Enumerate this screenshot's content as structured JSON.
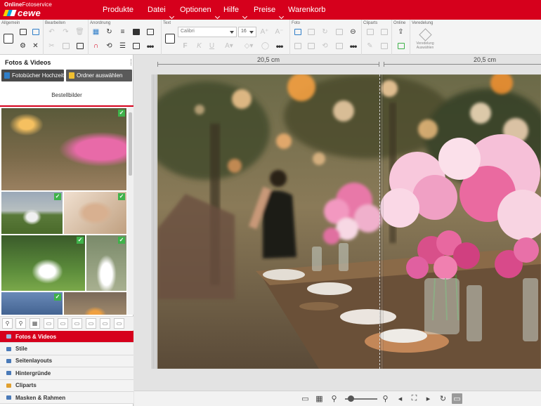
{
  "app": {
    "logo_top_bold": "Online",
    "logo_top_rest": "Fotoservice",
    "logo_brand": "cewe"
  },
  "menu": [
    {
      "label": "Produkte",
      "has_dropdown": false
    },
    {
      "label": "Datei",
      "has_dropdown": true
    },
    {
      "label": "Optionen",
      "has_dropdown": true
    },
    {
      "label": "Hilfe",
      "has_dropdown": true
    },
    {
      "label": "Preise",
      "has_dropdown": true
    },
    {
      "label": "Warenkorb",
      "has_dropdown": false
    }
  ],
  "toolbar": {
    "groups": [
      "Allgemein",
      "Bearbeiten",
      "Anordnung",
      "Text",
      "Foto",
      "Cliparts",
      "Online",
      "Veredelung"
    ],
    "font_value": "Calibri",
    "font_size_value": "16",
    "veredelung_label": "Veredelung Auswählen"
  },
  "left_panel": {
    "title": "Fotos & Videos",
    "source_buttons": [
      "Fotobücher Hochzeit",
      "Ordner auswählen"
    ],
    "sub_tab": "Bestellbilder",
    "check_mark": "✓",
    "accordion": [
      {
        "label": "Fotos & Videos",
        "active": true
      },
      {
        "label": "Stile",
        "active": false
      },
      {
        "label": "Seitenlayouts",
        "active": false
      },
      {
        "label": "Hintergründe",
        "active": false
      },
      {
        "label": "Cliparts",
        "active": false
      },
      {
        "label": "Masken & Rahmen",
        "active": false
      }
    ]
  },
  "canvas": {
    "left_page_width": "20,5 cm",
    "right_page_width": "20,5 cm"
  },
  "bottom_bar": {
    "zoom_level": 0.1
  },
  "colors": {
    "brand_red": "#d6001c",
    "check_green": "#3fb24a",
    "dark_button": "#4a4a4a"
  }
}
